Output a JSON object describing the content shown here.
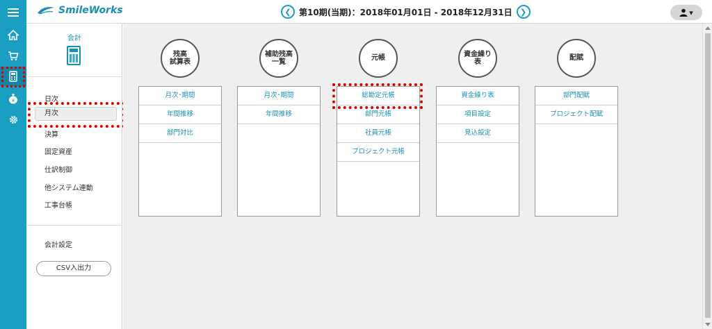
{
  "app": {
    "logo_text": "SmileWorks"
  },
  "header": {
    "period": "第10期(当期)：2018年01月01日 - 2018年12月31日",
    "prev_icon": "chevron-left-icon",
    "next_icon": "chevron-right-icon",
    "user_icon": "user-icon",
    "user_caret": "▾"
  },
  "rail": {
    "icons": [
      "menu-icon",
      "home-icon",
      "cart-icon",
      "calculator-icon",
      "yen-bag-icon",
      "gear-icon"
    ],
    "accent": "#1a9fc2"
  },
  "sidebar": {
    "title": "会計",
    "items": [
      "日次",
      "月次",
      "決算",
      "固定資産",
      "仕訳制御",
      "他システム連動",
      "工事台帳"
    ],
    "selected": "月次",
    "settings": "会計設定",
    "csv_button": "CSV入出力"
  },
  "main": {
    "columns": [
      {
        "title": "残高\n試算表",
        "items": [
          "月次･期間",
          "年間推移",
          "部門対比"
        ]
      },
      {
        "title": "補助残高\n一覧",
        "items": [
          "月次･期間",
          "年間推移"
        ]
      },
      {
        "title": "元帳",
        "items": [
          "総勘定元帳",
          "部門元帳",
          "社員元帳",
          "プロジェクト元帳"
        ]
      },
      {
        "title": "資金繰り\n表",
        "items": [
          "資金繰り表",
          "項目設定",
          "見込設定"
        ]
      },
      {
        "title": "配賦",
        "items": [
          "部門配賦",
          "プロジェクト配賦"
        ]
      }
    ]
  },
  "colors": {
    "highlight": "#e00000",
    "link": "#1a8fb4"
  }
}
